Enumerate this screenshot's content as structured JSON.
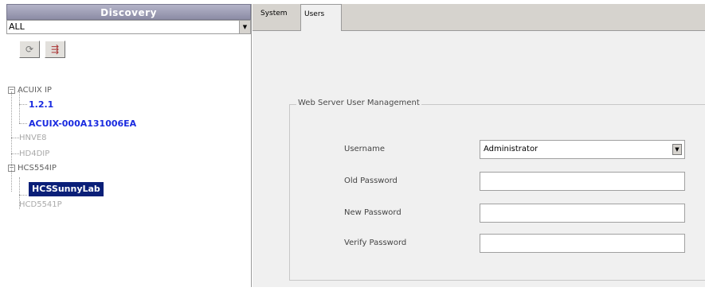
{
  "discovery": {
    "title": "Discovery",
    "filter_value": "ALL",
    "toolbar": [
      {
        "icon": "refresh-icon",
        "glyph": "⟳"
      },
      {
        "icon": "device-icon",
        "glyph": "⇶"
      }
    ]
  },
  "tree": [
    {
      "label": "ACUIX IP",
      "expander": "−",
      "style": "plain"
    },
    {
      "label": "1.2.1",
      "style": "blue"
    },
    {
      "label": "ACUIX-000A131006EA",
      "style": "blue"
    },
    {
      "label": "HNVE8",
      "style": "grey"
    },
    {
      "label": "HD4DIP",
      "style": "grey"
    },
    {
      "label": "HCS554IP",
      "expander": "−",
      "style": "plain"
    },
    {
      "label": "HCSSunnyLab",
      "style": "selected"
    },
    {
      "label": "HCD5541P",
      "style": "grey"
    }
  ],
  "tabs": {
    "system": "System",
    "users": "Users"
  },
  "user_management": {
    "legend": "Web Server User Management",
    "username_label": "Username",
    "username_value": "Administrator",
    "old_password_label": "Old Password",
    "new_password_label": "New Password",
    "verify_password_label": "Verify Password"
  },
  "colors": {
    "header_gradient_top": "#b3b3c8",
    "header_gradient_bottom": "#8d8da6",
    "tree_link_blue": "#1a2be0",
    "selection_navy": "#0a1f78",
    "panel_bg": "#f0f0f0",
    "tab_strip": "#d6d3ce"
  }
}
